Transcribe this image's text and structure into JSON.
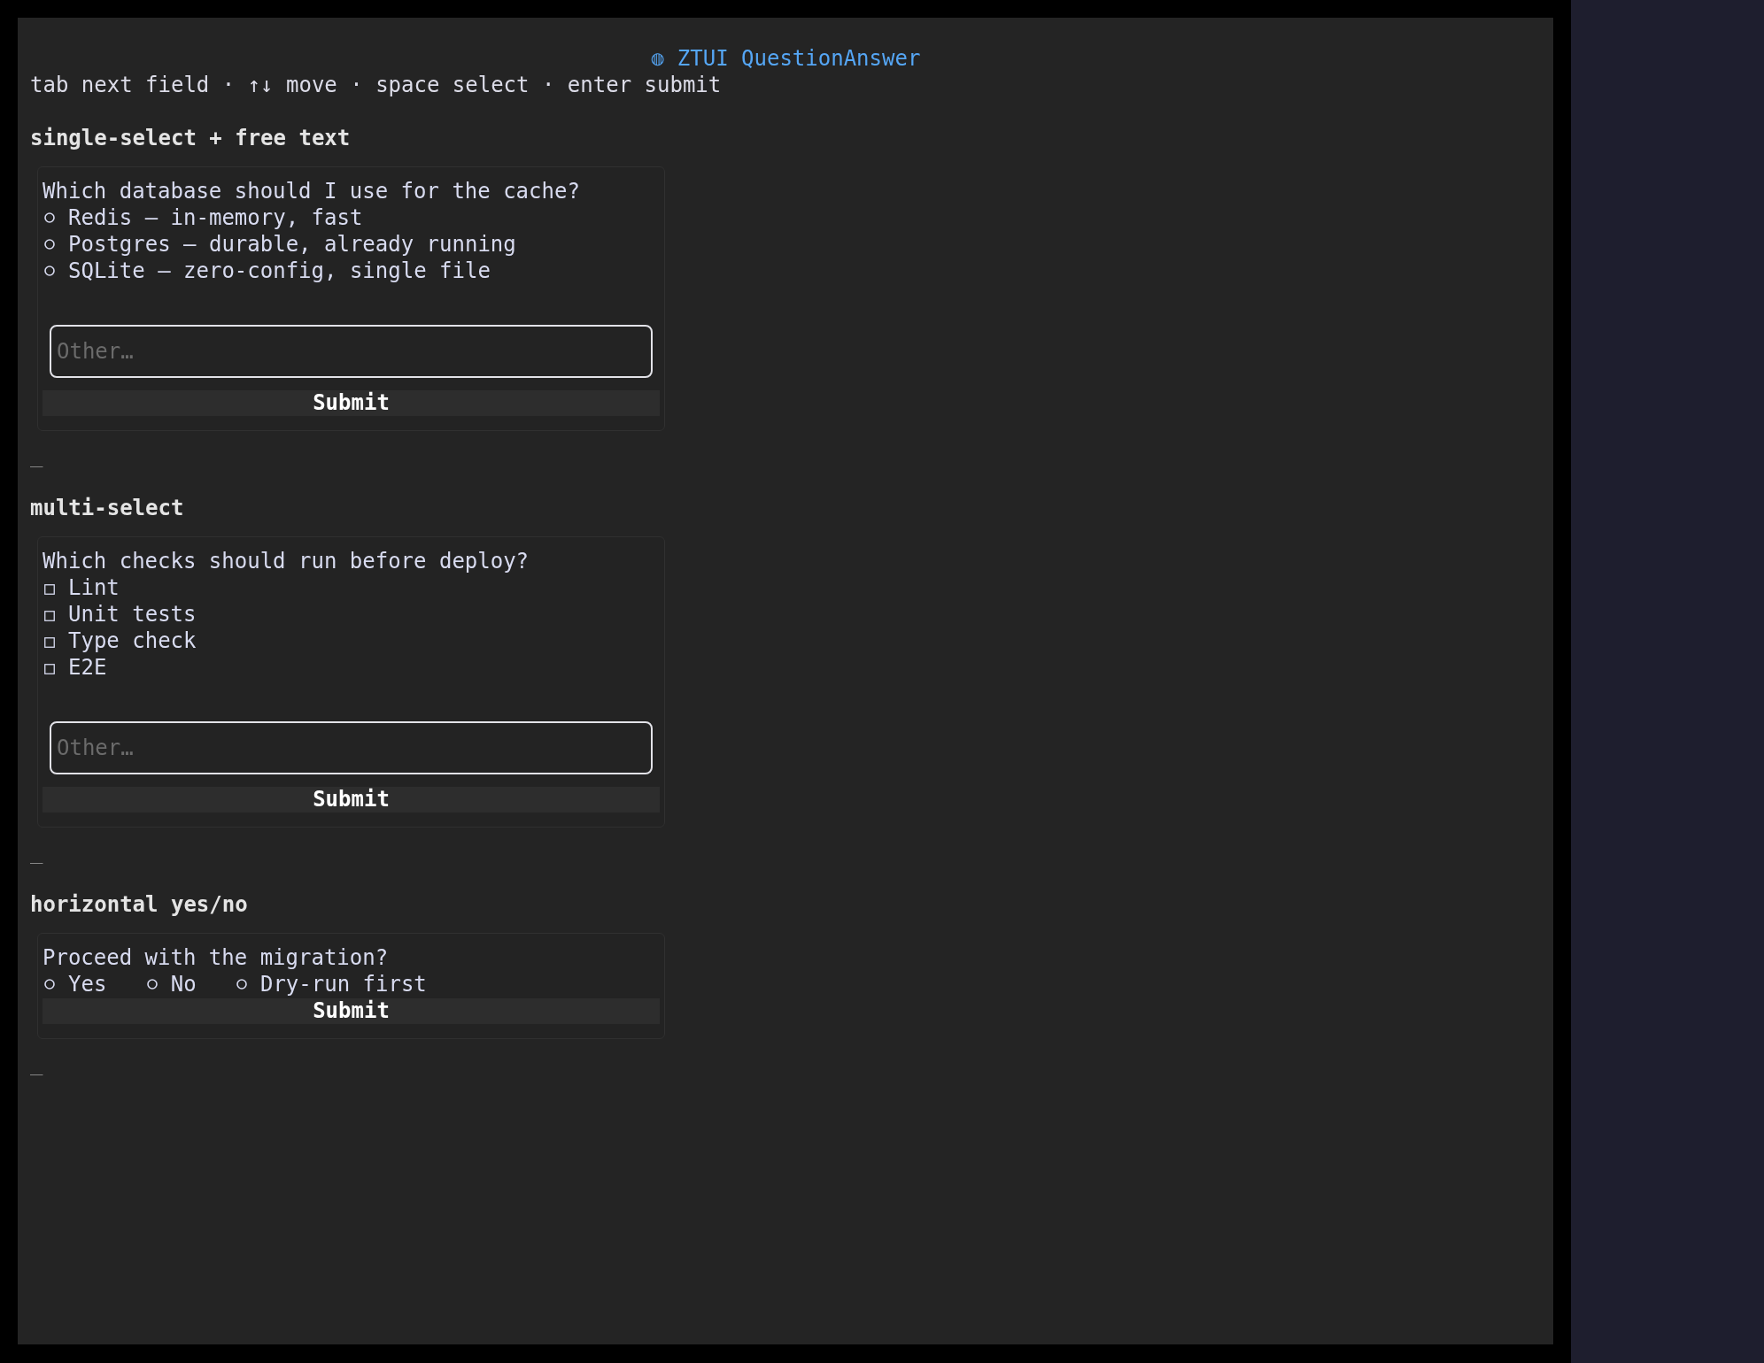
{
  "app": {
    "title_glyph": "◍",
    "title": "ZTUI QuestionAnswer",
    "hint": "tab next field · ↑↓ move · space select · enter submit"
  },
  "sections": [
    {
      "heading": "single-select + free text",
      "kind": "single",
      "horizontal": false,
      "question": "Which database should I use for the cache?",
      "options": [
        {
          "label": "Redis — in-memory, fast",
          "selected": false
        },
        {
          "label": "Postgres — durable, already running",
          "selected": false
        },
        {
          "label": "SQLite — zero-config, single file",
          "selected": false
        }
      ],
      "other_field": {
        "placeholder": "Other…"
      },
      "submit": "Submit",
      "end_mark": "_"
    },
    {
      "heading": "multi-select",
      "kind": "multi",
      "horizontal": false,
      "question": "Which checks should run before deploy?",
      "options": [
        {
          "label": "Lint",
          "checked": false
        },
        {
          "label": "Unit tests",
          "checked": false
        },
        {
          "label": "Type check",
          "checked": false
        },
        {
          "label": "E2E",
          "checked": false
        }
      ],
      "other_field": {
        "placeholder": "Other…"
      },
      "submit": "Submit",
      "end_mark": "_"
    },
    {
      "heading": "horizontal yes/no",
      "kind": "single",
      "horizontal": true,
      "question": "Proceed with the migration?",
      "options": [
        {
          "label": "Yes",
          "selected": false
        },
        {
          "label": "No",
          "selected": false
        },
        {
          "label": "Dry-run first",
          "selected": false
        }
      ],
      "submit": "Submit",
      "end_mark": "_"
    }
  ]
}
